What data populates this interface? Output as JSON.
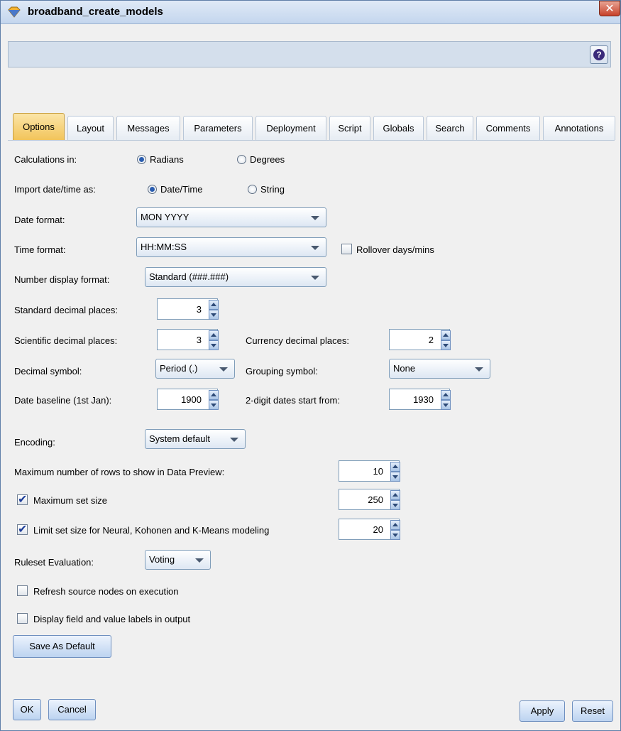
{
  "window": {
    "title": "broadband_create_models",
    "close_glyph": "✕"
  },
  "toolbar": {
    "help_icon": "?"
  },
  "tabs": [
    {
      "label": "Options"
    },
    {
      "label": "Layout"
    },
    {
      "label": "Messages"
    },
    {
      "label": "Parameters"
    },
    {
      "label": "Deployment"
    },
    {
      "label": "Script"
    },
    {
      "label": "Globals"
    },
    {
      "label": "Search"
    },
    {
      "label": "Comments"
    },
    {
      "label": "Annotations"
    }
  ],
  "options": {
    "calculations": {
      "label": "Calculations in:",
      "opt1": "Radians",
      "opt2": "Degrees"
    },
    "import_date": {
      "label": "Import date/time as:",
      "opt1": "Date/Time",
      "opt2": "String"
    },
    "date_format": {
      "label": "Date format:",
      "value": "MON YYYY"
    },
    "time_format": {
      "label": "Time format:",
      "value": "HH:MM:SS",
      "rollover": "Rollover days/mins"
    },
    "number_display": {
      "label": "Number display format:",
      "value": "Standard (###.###)"
    },
    "standard_decimal": {
      "label": "Standard decimal places:",
      "value": "3"
    },
    "scientific_decimal": {
      "label": "Scientific decimal places:",
      "value": "3"
    },
    "currency_decimal": {
      "label": "Currency decimal places:",
      "value": "2"
    },
    "decimal_symbol": {
      "label": "Decimal symbol:",
      "value": "Period (.)"
    },
    "grouping_symbol": {
      "label": "Grouping symbol:",
      "value": "None"
    },
    "date_baseline": {
      "label": "Date baseline (1st Jan):",
      "value": "1900"
    },
    "two_digit": {
      "label": "2-digit dates start from:",
      "value": "1930"
    },
    "encoding": {
      "label": "Encoding:",
      "value": "System default"
    },
    "max_rows": {
      "label": "Maximum number of rows to show in Data Preview:",
      "value": "10"
    },
    "max_set": {
      "label": "Maximum set size",
      "value": "250",
      "checked": true
    },
    "limit_set": {
      "label": "Limit set size for Neural, Kohonen and K-Means modeling",
      "value": "20",
      "checked": true
    },
    "ruleset": {
      "label": "Ruleset Evaluation:",
      "value": "Voting"
    },
    "refresh": {
      "label": "Refresh source nodes on execution",
      "checked": false
    },
    "display_labels": {
      "label": "Display field and value labels in output",
      "checked": false
    },
    "save_default": "Save As Default"
  },
  "footer": {
    "ok": "OK",
    "cancel": "Cancel",
    "apply": "Apply",
    "reset": "Reset"
  }
}
